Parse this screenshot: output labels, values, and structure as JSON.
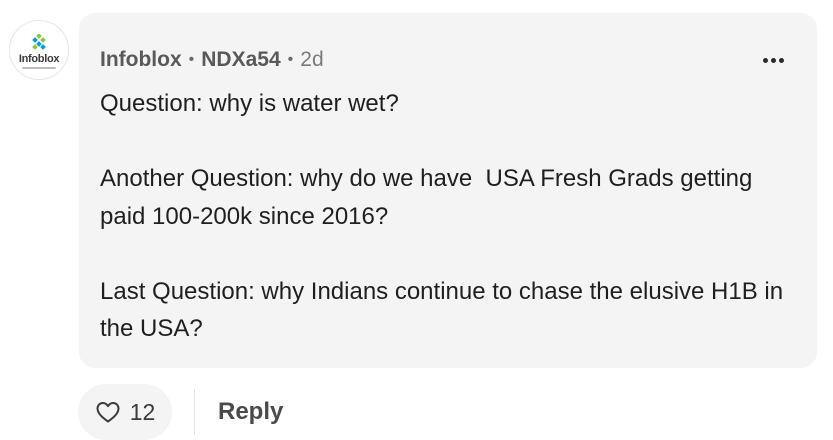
{
  "post": {
    "avatar": {
      "logo_text": "Infoblox",
      "icon": "infoblox-logo-icon"
    },
    "meta": {
      "company": "Infoblox",
      "separator": "•",
      "handle": "NDXa54",
      "time": "2d"
    },
    "more_icon": "more-horizontal-icon",
    "paragraphs": [
      "Question: why is water wet?",
      "Another Question: why do we have  USA Fresh Grads getting paid 100-200k since 2016?",
      "Last Question: why Indians continue to chase the elusive H1B in the USA?"
    ]
  },
  "actions": {
    "like_icon": "heart-icon",
    "like_count": "12",
    "reply_label": "Reply"
  },
  "colors": {
    "bubble_bg": "#f4f4f5",
    "text": "#1f1f1f",
    "meta": "#58595b",
    "logo_green": "#8cc63f",
    "logo_blue": "#00a0dc"
  }
}
